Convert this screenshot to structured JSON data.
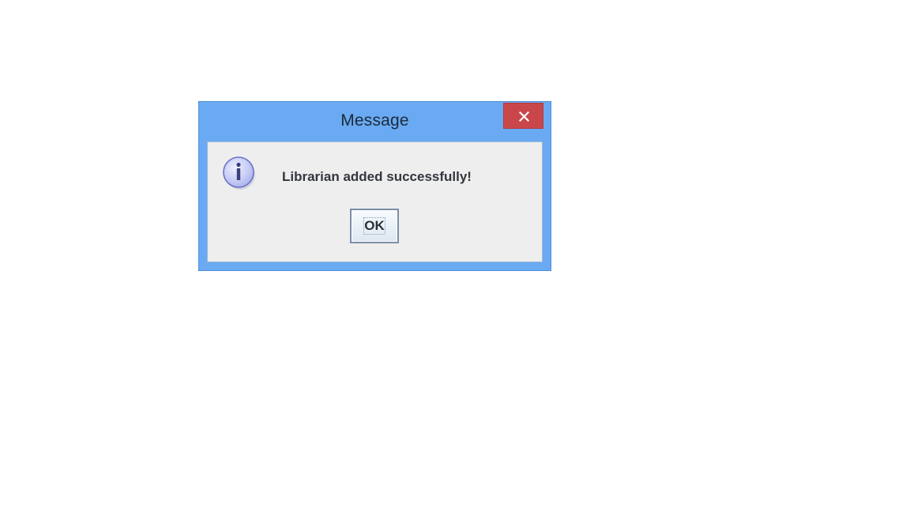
{
  "dialog": {
    "title": "Message",
    "message": "Librarian added successfully!",
    "ok_label": "OK",
    "close_symbol": "×",
    "icon": "info-icon"
  },
  "colors": {
    "titlebar": "#6aaaf2",
    "close_button": "#c9464a",
    "content_background": "#eeeeee",
    "info_icon_fill": "#c8cdf6",
    "info_icon_stroke": "#6a73c9"
  }
}
